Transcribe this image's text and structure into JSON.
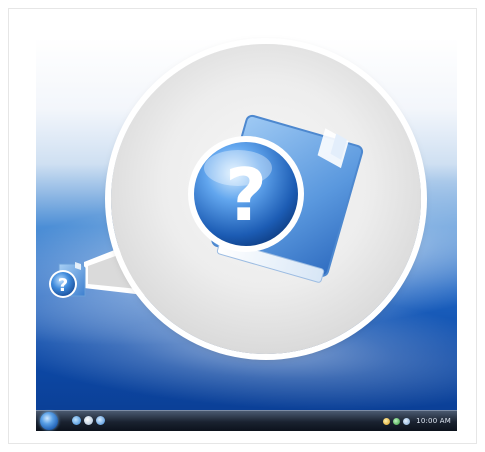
{
  "desktop": {
    "icon_name": "help-folder-icon",
    "magnified_icon_name": "help-folder-icon"
  },
  "taskbar": {
    "start_icon": "windows-start-orb-icon",
    "quick_launch_icons": [
      "ie-icon",
      "show-desktop-icon",
      "switch-windows-icon"
    ],
    "tray_icons": [
      "network-icon",
      "security-icon",
      "volume-icon"
    ],
    "clock": "10:00 AM"
  },
  "colors": {
    "desktop_blue": "#1e64c2",
    "icon_blue": "#3b7fd4",
    "callout_gray": "#e3e3e3"
  }
}
